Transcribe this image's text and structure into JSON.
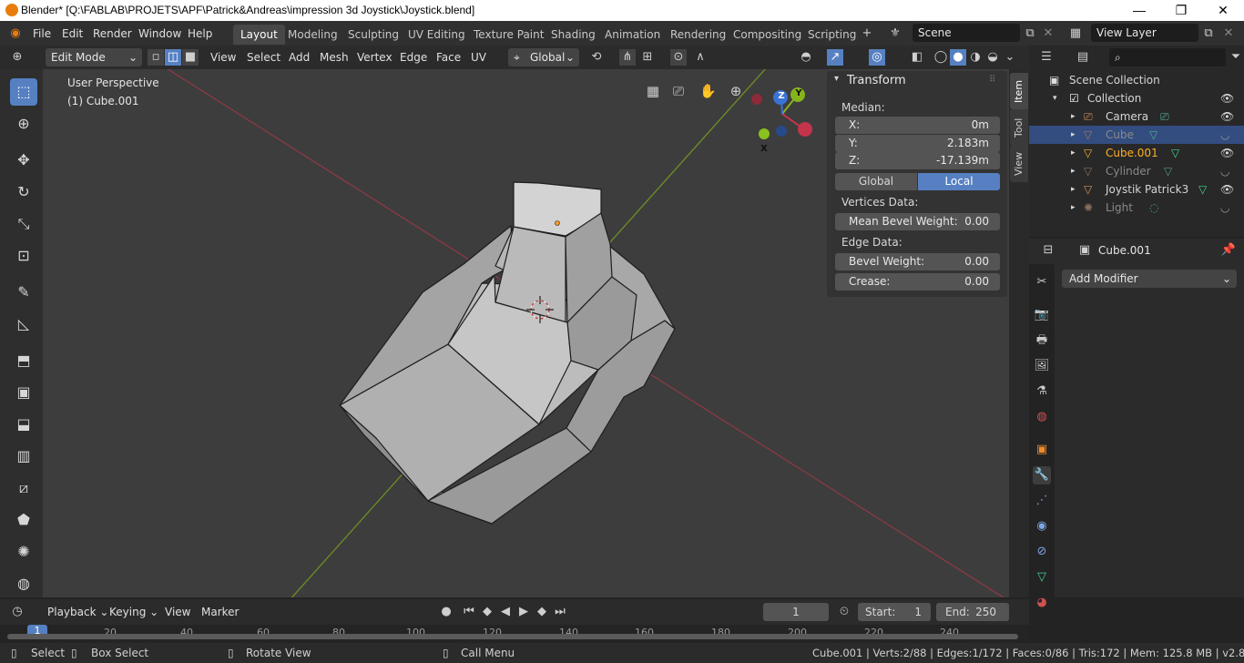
{
  "titlebar": {
    "title": "Blender* [Q:\\FABLAB\\PROJETS\\APF\\Patrick&Andreas\\impression 3d Joystick\\Joystick.blend]",
    "minimize": "—",
    "maximize": "❐",
    "close": "✕"
  },
  "menu": [
    "File",
    "Edit",
    "Render",
    "Window",
    "Help"
  ],
  "workspaces": [
    "Layout",
    "Modeling",
    "Sculpting",
    "UV Editing",
    "Texture Paint",
    "Shading",
    "Animation",
    "Rendering",
    "Compositing",
    "Scripting"
  ],
  "active_workspace": "Layout",
  "scene": {
    "name": "Scene",
    "view_layer": "View Layer"
  },
  "viewport_header": {
    "mode": "Edit Mode",
    "menus": [
      "View",
      "Select",
      "Add",
      "Mesh",
      "Vertex",
      "Edge",
      "Face",
      "UV"
    ],
    "orientation": "Global"
  },
  "viewport": {
    "view_name": "User Perspective",
    "object_label": "(1) Cube.001",
    "gizmo": {
      "x": "X",
      "y": "Y",
      "z": "Z"
    }
  },
  "npanel": {
    "section": "Transform",
    "median_label": "Median:",
    "fields": [
      {
        "label": "X:",
        "value": "0m"
      },
      {
        "label": "Y:",
        "value": "2.183m"
      },
      {
        "label": "Z:",
        "value": "-17.139m"
      }
    ],
    "toggle": [
      "Global",
      "Local"
    ],
    "active_toggle": "Local",
    "vertices_label": "Vertices Data:",
    "mean_bevel": {
      "label": "Mean Bevel Weight:",
      "value": "0.00"
    },
    "edge_label": "Edge Data:",
    "bevel_weight": {
      "label": "Bevel Weight:",
      "value": "0.00"
    },
    "crease": {
      "label": "Crease:",
      "value": "0.00"
    },
    "tabs": [
      "Item",
      "Tool",
      "View"
    ]
  },
  "outliner": {
    "scene_collection": "Scene Collection",
    "collection": "Collection",
    "items": [
      "Camera",
      "Cube",
      "Cube.001",
      "Cylinder",
      "Joystik Patrick3",
      "Light"
    ]
  },
  "properties": {
    "object_name": "Cube.001",
    "add_modifier": "Add Modifier"
  },
  "timeline": {
    "menus": [
      "Playback",
      "Keying",
      "View",
      "Marker"
    ],
    "current_frame": "1",
    "start_label": "Start:",
    "start": "1",
    "end_label": "End:",
    "end": "250",
    "ruler": [
      "1",
      "20",
      "40",
      "60",
      "80",
      "100",
      "120",
      "140",
      "160",
      "180",
      "200",
      "220",
      "240"
    ]
  },
  "statusbar": {
    "select": "Select",
    "box_select": "Box Select",
    "rotate_view": "Rotate View",
    "call_menu": "Call Menu",
    "stats": "Cube.001 | Verts:2/88 | Edges:1/172 | Faces:0/86 | Tris:172 | Mem: 125.8 MB | v2.80.75"
  },
  "colors": {
    "accent": "#5680c2",
    "active_object": "#ffaf29",
    "x_axis": "#c4344b",
    "y_axis": "#86b31c",
    "z_axis": "#3a73d6"
  }
}
